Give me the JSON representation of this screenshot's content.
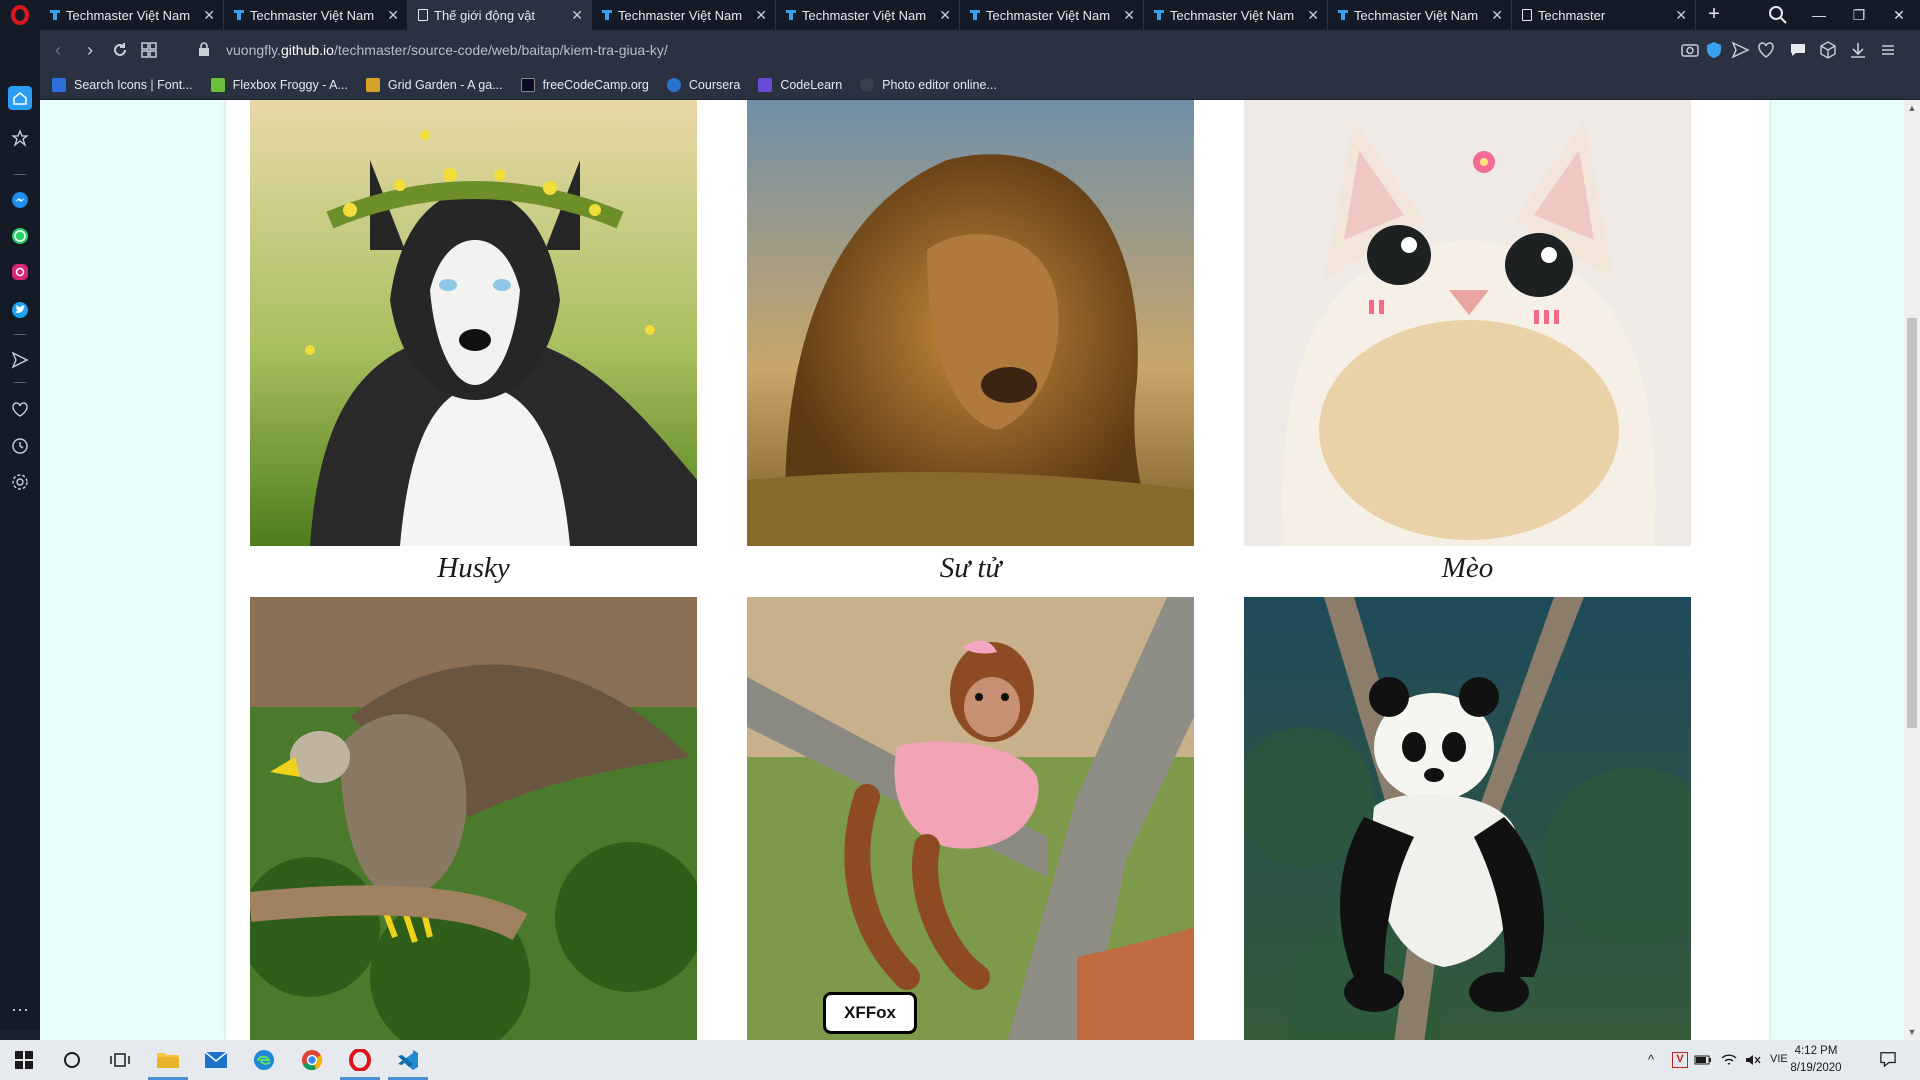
{
  "browser": {
    "tabs": [
      {
        "title": "Techmaster Việt Nam",
        "active": false,
        "icon": "techmaster-icon"
      },
      {
        "title": "Techmaster Việt Nam",
        "active": false,
        "icon": "techmaster-icon"
      },
      {
        "title": "Thế giới động vật",
        "active": true,
        "icon": "document-icon"
      },
      {
        "title": "Techmaster Việt Nam",
        "active": false,
        "icon": "techmaster-icon"
      },
      {
        "title": "Techmaster Việt Nam",
        "active": false,
        "icon": "techmaster-icon"
      },
      {
        "title": "Techmaster Việt Nam",
        "active": false,
        "icon": "techmaster-icon"
      },
      {
        "title": "Techmaster Việt Nam",
        "active": false,
        "icon": "techmaster-icon"
      },
      {
        "title": "Techmaster Việt Nam",
        "active": false,
        "icon": "techmaster-icon"
      },
      {
        "title": "Techmaster",
        "active": false,
        "icon": "document-icon"
      }
    ],
    "tab_close_glyph": "✕",
    "new_tab_glyph": "+",
    "window_controls": {
      "minimize": "—",
      "restore": "❐",
      "close": "✕"
    },
    "url": {
      "prefix": "vuongfly.",
      "domain": "github.io",
      "path": "/techmaster/source-code/web/baitap/kiem-tra-giua-ky/"
    },
    "bookmarks": [
      {
        "label": "Search Icons | Font...",
        "color": "#2f6fd9"
      },
      {
        "label": "Flexbox Froggy - A...",
        "color": "#6bbf3b"
      },
      {
        "label": "Grid Garden - A ga...",
        "color": "#d6a326"
      },
      {
        "label": "freeCodeCamp.org",
        "color": "#0a0a23"
      },
      {
        "label": "Coursera",
        "color": "#2a73cc"
      },
      {
        "label": "CodeLearn",
        "color": "#6a4bd8"
      },
      {
        "label": "Photo editor online...",
        "color": "#3a3f4a"
      }
    ],
    "accent_color": "#e0161e"
  },
  "page": {
    "background": "#e9fdfd",
    "animals": [
      {
        "name": "Husky",
        "image": "husky-photo"
      },
      {
        "name": "Sư tử",
        "image": "lion-photo"
      },
      {
        "name": "Mèo",
        "image": "cat-photo"
      },
      {
        "name": "",
        "image": "eagle-photo"
      },
      {
        "name": "",
        "image": "monkey-photo"
      },
      {
        "name": "",
        "image": "panda-photo"
      }
    ],
    "overlay_badge": "XFFox"
  },
  "taskbar": {
    "apps": [
      "start-icon",
      "cortana-icon",
      "task-view-icon",
      "file-explorer-icon",
      "mail-icon",
      "edge-icon",
      "chrome-icon",
      "opera-icon",
      "vscode-icon"
    ],
    "language": "VIE",
    "time": "4:12 PM",
    "date": "8/19/2020"
  }
}
